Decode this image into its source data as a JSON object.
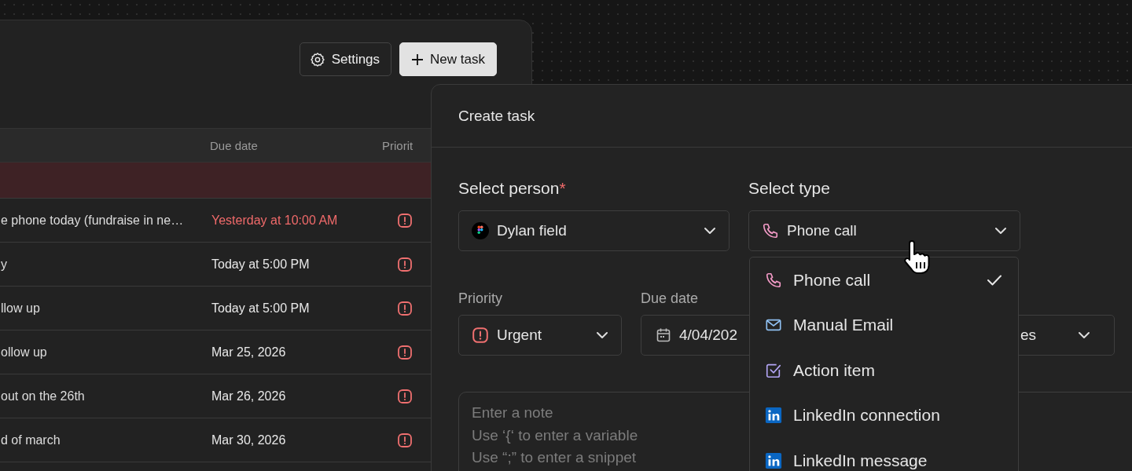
{
  "toolbar": {
    "buttons": [
      {
        "label": "Settings",
        "kind": "settings"
      },
      {
        "label": "New task",
        "kind": "new"
      }
    ]
  },
  "table": {
    "columns": [
      {
        "label": "Due date"
      },
      {
        "label": "Priorit"
      }
    ],
    "overdue_band": true,
    "rows": [
      {
        "task": "e phone today (fundraise in ne…",
        "due": "Yesterday at 10:00 AM",
        "overdue": true,
        "kind": "urgent"
      },
      {
        "task": "y",
        "due": "Today at 5:00 PM",
        "overdue": false,
        "kind": "urgent"
      },
      {
        "task": "llow up",
        "due": "Today at 5:00 PM",
        "overdue": false,
        "kind": "urgent"
      },
      {
        "task": "ollow up",
        "due": "Mar 25, 2026",
        "overdue": false,
        "kind": "urgent"
      },
      {
        "task": "out on the 26th",
        "due": "Mar 26, 2026",
        "overdue": false,
        "kind": "urgent"
      },
      {
        "task": "d of march",
        "due": "Mar 30, 2026",
        "overdue": false,
        "kind": "urgent"
      }
    ]
  },
  "modal": {
    "title": "Create task",
    "person": {
      "label": "Select person",
      "required_mark": "*",
      "value": "Dylan field"
    },
    "type": {
      "label": "Select type",
      "value": "Phone call",
      "kind": "phone"
    },
    "priority": {
      "label": "Priority",
      "value": "Urgent",
      "kind": "urgent"
    },
    "due_date": {
      "label": "Due date",
      "value": "4/04/202"
    },
    "field_3": {
      "value": "es"
    },
    "note": {
      "placeholder": "Enter a note\nUse ‘{‘ to enter a variable\nUse “;” to enter a snippet"
    }
  },
  "type_menu": {
    "items": [
      {
        "label": "Phone call",
        "kind": "phone",
        "selected": true
      },
      {
        "label": "Manual Email",
        "kind": "email",
        "selected": false
      },
      {
        "label": "Action item",
        "kind": "action",
        "selected": false
      },
      {
        "label": "LinkedIn connection",
        "kind": "linkedin",
        "selected": false
      },
      {
        "label": "LinkedIn message",
        "kind": "linkedin",
        "selected": false
      }
    ]
  }
}
